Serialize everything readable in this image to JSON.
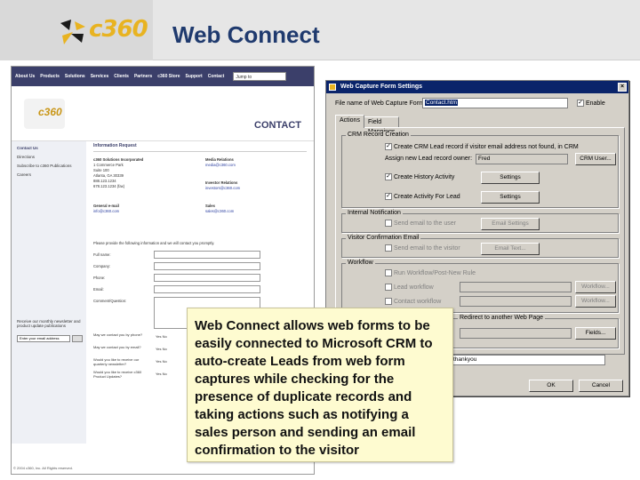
{
  "header": {
    "logo_text": "c360",
    "title": "Web Connect"
  },
  "website": {
    "nav": [
      "About Us",
      "Products",
      "Solutions",
      "Services",
      "Clients",
      "Partners",
      "c360 Store",
      "Support",
      "Contact"
    ],
    "jump_select": "Jump to",
    "logo_text": "c360",
    "page_heading": "CONTACT",
    "left_nav": [
      "Contact Us",
      "Directions",
      "Subscribe to c360 Publications",
      "Careers"
    ],
    "newsletter_text": "Receive our monthly newsletter and product update publications",
    "newsletter_placeholder": "Enter your email address",
    "request_heading": "Information Request",
    "company_block": [
      "c360 Solutions Incorporated",
      "1 Commerce Park",
      "Suite 100",
      "Atlanta, GA 30339",
      "888.123.1234",
      "678.123.1234 (fax)"
    ],
    "media_block": [
      "Media Relations",
      "media@c360.com"
    ],
    "investor_block": [
      "Investor Relations",
      "investors@c360.com"
    ],
    "general_block": [
      "General e-mail",
      "info@c360.com"
    ],
    "sales_block": [
      "Sales",
      "sales@c360.com"
    ],
    "intro_text": "Please provide the following information and we will contact you promptly.",
    "form_fields": [
      "Full name:",
      "Company:",
      "Phone:",
      "Email:"
    ],
    "comment_label": "Comment/Question:",
    "radio_questions": [
      "May we contact you by phone?",
      "May we contact you by email?",
      "Would you like to receive our quarterly newsletter?",
      "Would you like to receive c360 Product Updates?"
    ],
    "radio_options": "Yes  No",
    "footer": "© 2004 c360, Inc. All Rights reserved."
  },
  "dialog": {
    "title": "Web Capture Form Settings",
    "file_name_label": "File name of Web Capture Form:",
    "file_name_value": "Contact.htm",
    "enable_label": "Enable",
    "tabs": [
      "Actions",
      "Field Mappings"
    ],
    "group_crm": "CRM Record Creation",
    "create_lead": "Create CRM Lead record if visitor email address not found, in CRM",
    "assign_owner_label": "Assign new Lead record owner:",
    "owner_value": "Fred",
    "crm_user_button": "CRM User...",
    "create_history": "Create History Activity",
    "create_activity": "Create Activity For Lead",
    "settings_button": "Settings",
    "group_internal": "Internal Notification",
    "send_internal": "Send email to the user",
    "email_settings_button": "Email Settings",
    "group_visitor": "Visitor Confirmation Email",
    "send_visitor": "Send email to the visitor",
    "email_text_button": "Email Text...",
    "group_workflow": "Workflow",
    "run_workflow": "Run Workflow/Post-New Rule",
    "lead_workflow": "Lead workflow",
    "contact_workflow": "Contact workflow",
    "workflow_button": "Workflow...",
    "redirect_text": "Redirect to another Web Page",
    "fields_button": "Fields...",
    "redirect_value": "thankyou",
    "ok_button": "OK",
    "cancel_button": "Cancel"
  },
  "callout": {
    "text": "Web Connect allows web forms to be easily connected to Microsoft CRM to auto-create Leads from web form captures while checking for the presence of duplicate records and taking actions such as notifying a sales person and sending an email confirmation to the visitor"
  }
}
